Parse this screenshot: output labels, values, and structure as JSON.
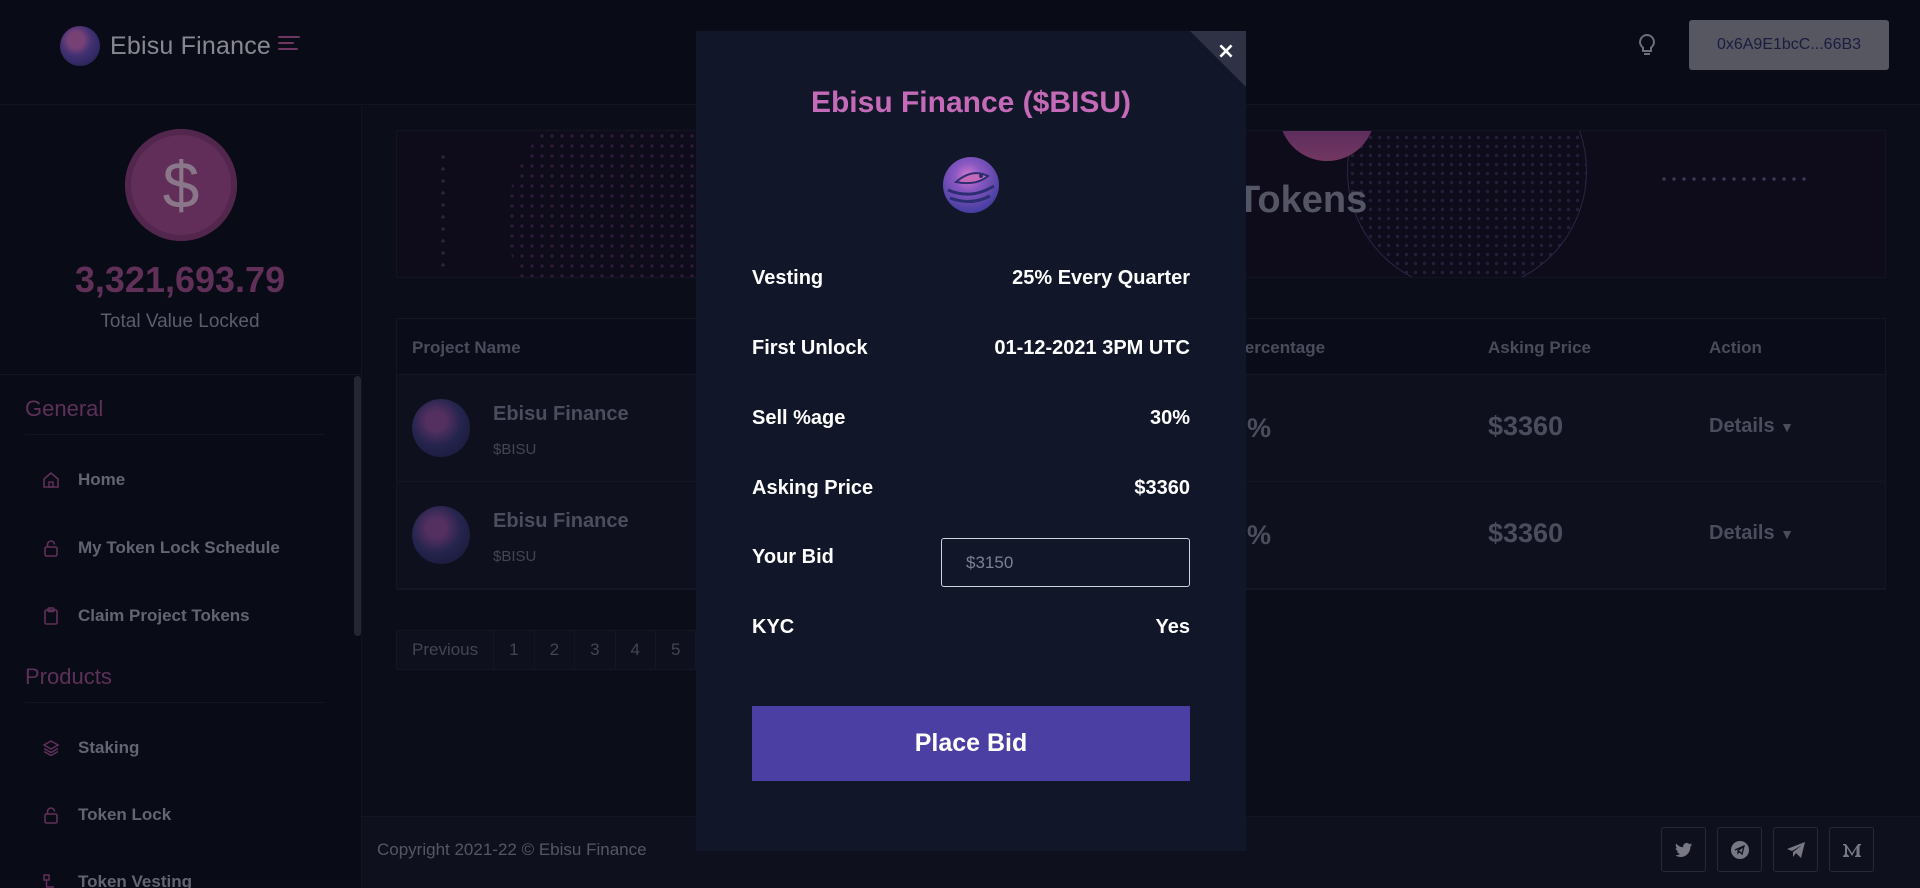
{
  "header": {
    "brand_name": "Ebisu Finance",
    "wallet_address": "0x6A9E1bcC...66B3"
  },
  "sidebar": {
    "tvl_value": "3,321,693.79",
    "tvl_label": "Total Value Locked",
    "tvl_icon": "$",
    "sections": [
      {
        "title": "General",
        "items": [
          {
            "label": "Home",
            "icon": "home-icon"
          },
          {
            "label": "My Token Lock Schedule",
            "icon": "lock-icon"
          },
          {
            "label": "Claim Project Tokens",
            "icon": "clipboard-icon"
          }
        ]
      },
      {
        "title": "Products",
        "items": [
          {
            "label": "Staking",
            "icon": "layers-icon"
          },
          {
            "label": "Token Lock",
            "icon": "lock-icon"
          },
          {
            "label": "Token Vesting",
            "icon": "vesting-icon"
          }
        ]
      }
    ]
  },
  "banner": {
    "title_visible": "Tokens"
  },
  "table": {
    "columns": [
      "Project Name",
      "l Percentage",
      "Asking Price",
      "Action"
    ],
    "rows": [
      {
        "name": "Ebisu Finance",
        "symbol": "$BISU",
        "percentage": "%",
        "asking_price": "$3360",
        "action": "Details"
      },
      {
        "name": "Ebisu Finance",
        "symbol": "$BISU",
        "percentage": "%",
        "asking_price": "$3360",
        "action": "Details"
      }
    ]
  },
  "pagination": {
    "previous": "Previous",
    "pages": [
      "1",
      "2",
      "3",
      "4",
      "5"
    ]
  },
  "footer": {
    "copyright": "Copyright 2021-22 © Ebisu Finance",
    "social_icons": [
      "twitter-icon",
      "telegram-icon",
      "send-icon",
      "medium-icon"
    ]
  },
  "modal": {
    "title": "Ebisu Finance ($BISU)",
    "close_symbol": "×",
    "fields": [
      {
        "label": "Vesting",
        "value": "25% Every Quarter"
      },
      {
        "label": "First Unlock",
        "value": "01-12-2021 3PM UTC"
      },
      {
        "label": "Sell %age",
        "value": "30%"
      },
      {
        "label": "Asking Price",
        "value": "$3360"
      }
    ],
    "bid_label": "Your Bid",
    "bid_placeholder": "$3150",
    "kyc_label": "KYC",
    "kyc_value": "Yes",
    "submit_label": "Place Bid"
  },
  "colors": {
    "accent": "#c56ab8",
    "button": "#4b3fa3",
    "background": "#0f1220"
  }
}
